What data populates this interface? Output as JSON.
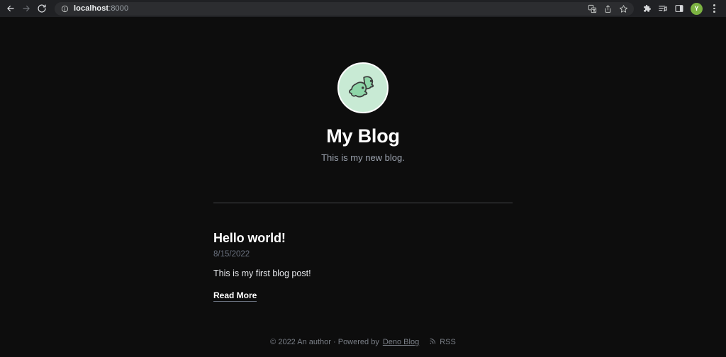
{
  "browser": {
    "back_label": "Back",
    "forward_label": "Forward",
    "reload_label": "Reload",
    "site_info_label": "View site information",
    "url_host": "localhost",
    "url_rest": ":8000",
    "url_full": "localhost:8000",
    "translate_label": "Translate this page",
    "share_label": "Share this page",
    "bookmark_label": "Bookmark this tab",
    "extensions_label": "Extensions",
    "media_label": "Media controls",
    "side_panel_label": "Side panel",
    "avatar_initial": "Y",
    "menu_label": "Customize and control Google Chrome",
    "colors": {
      "toolbar_bg": "#202124",
      "omnibox_bg": "#2c2d30",
      "avatar_green": "#7cb342",
      "icon": "#c4c7c5"
    }
  },
  "blog": {
    "logo_alt": "Deno blog dinosaur avatar",
    "title": "My Blog",
    "tagline": "This is my new blog.",
    "posts": [
      {
        "title": "Hello world!",
        "date": "8/15/2022",
        "snippet": "This is my first blog post!",
        "read_more": "Read More"
      }
    ],
    "footer": {
      "copyright": "© 2022 An author · Powered by",
      "powered_by_link": "Deno Blog",
      "rss_label": "RSS"
    },
    "colors": {
      "page_bg": "#0d0d0d",
      "text": "#ffffff",
      "muted": "#9ca3af",
      "date": "#6b7280",
      "divider": "#44474a",
      "logo_bg": "#c8ead4",
      "logo_fill": "#8ed6a8"
    }
  }
}
